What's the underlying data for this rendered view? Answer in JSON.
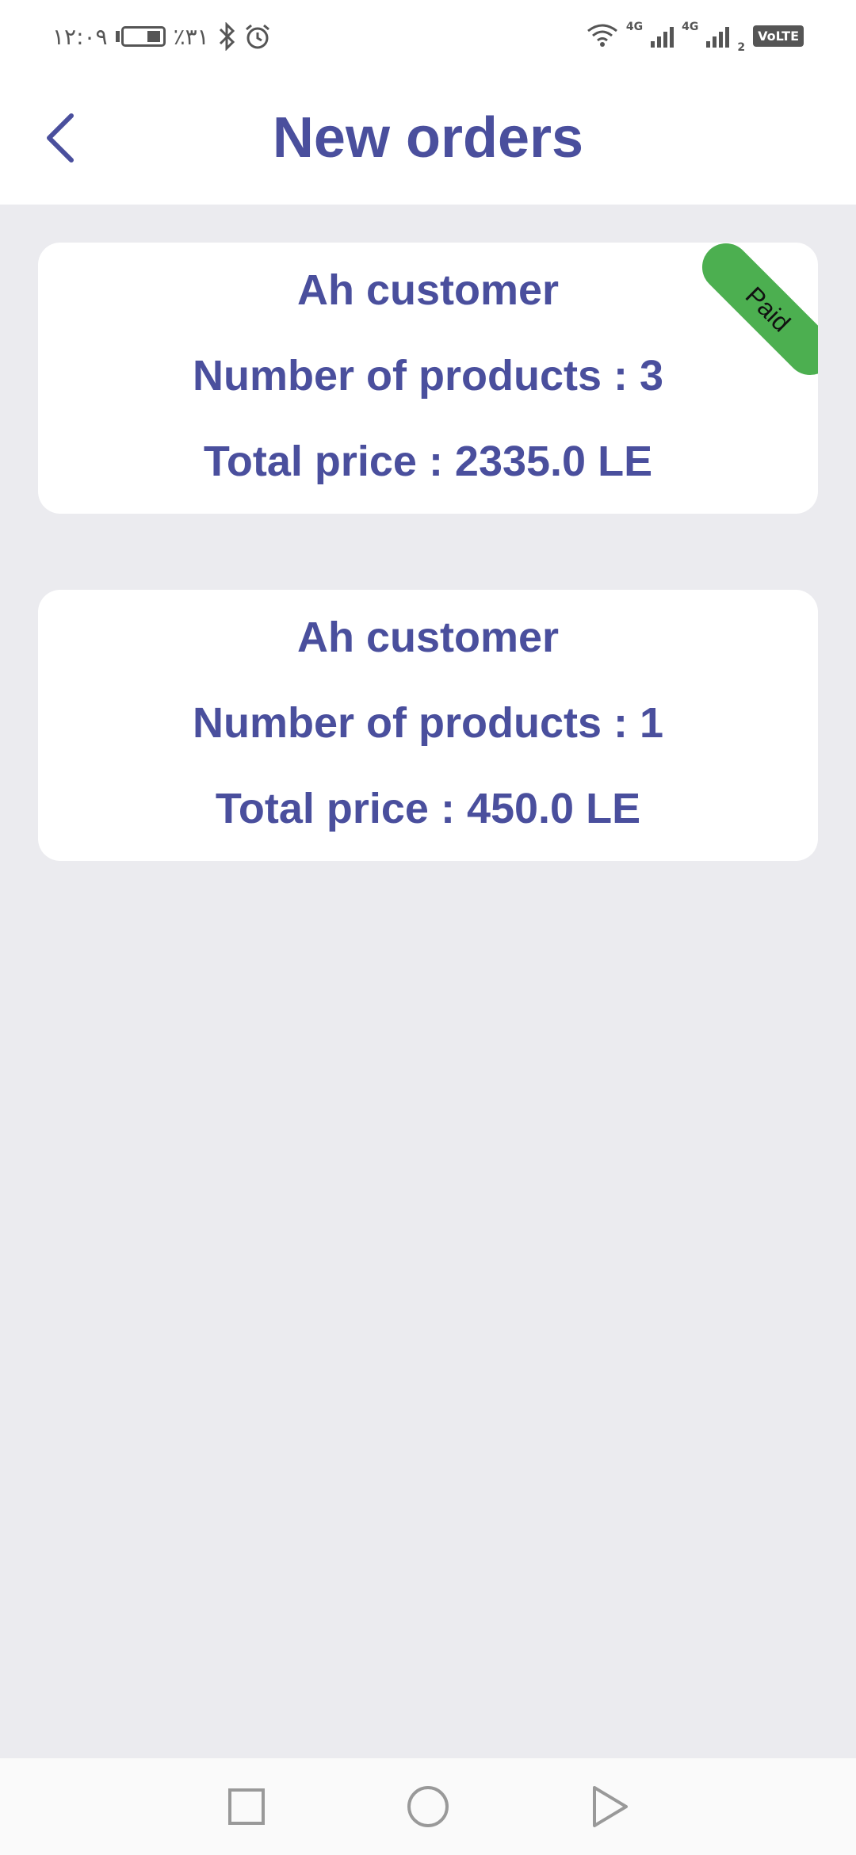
{
  "status_bar": {
    "time": "۱۲:۰۹",
    "battery_percent": "٪۳۱",
    "network_1": "4G",
    "network_2": "4G",
    "sim_2_label": "2",
    "volte": "VoLTE"
  },
  "app_bar": {
    "title": "New orders"
  },
  "orders": [
    {
      "customer": "Ah customer",
      "products_line": "Number of products : 3",
      "price_line": "Total price : 2335.0 LE",
      "badge": "Paid"
    },
    {
      "customer": "Ah customer",
      "products_line": "Number of products : 1",
      "price_line": "Total price : 450.0 LE"
    }
  ],
  "colors": {
    "accent": "#4a4f9d",
    "paid_badge": "#4caf50",
    "background": "#ebebef",
    "card": "#ffffff"
  },
  "icons": {
    "back": "chevron-left-icon",
    "nav_recent": "square-icon",
    "nav_home": "circle-icon",
    "nav_back": "triangle-icon"
  }
}
